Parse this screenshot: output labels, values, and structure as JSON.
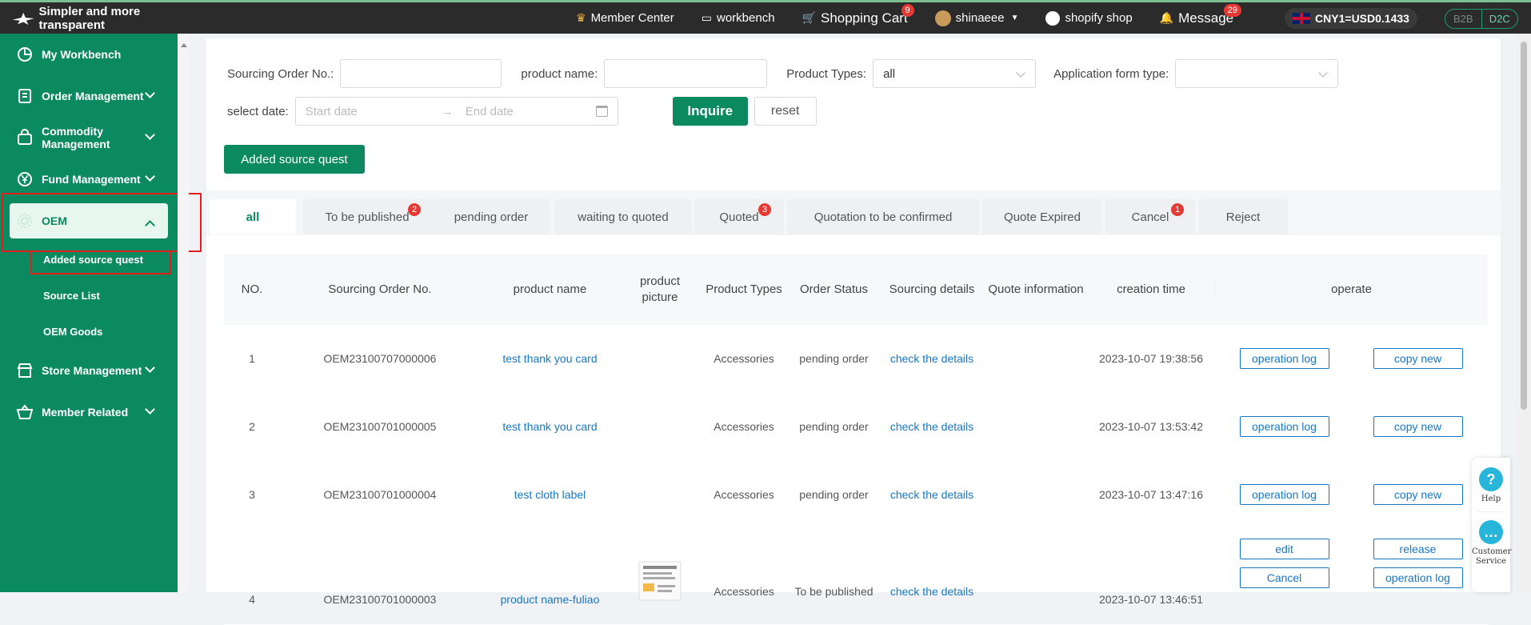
{
  "topbar": {
    "logo_text": "Simpler and more transparent",
    "member_center": "Member Center",
    "workbench": "workbench",
    "shopping_cart": "Shopping Cart",
    "cart_count": "9",
    "user": "shinaeee",
    "shopify_shop": "shopify shop",
    "message": "Message",
    "message_count": "29",
    "currency": "CNY1=USD0.1433",
    "mode_b2b": "B2B",
    "mode_d2c": "D2C"
  },
  "sidebar": {
    "items": [
      {
        "label": "My Workbench"
      },
      {
        "label": "Order Management"
      },
      {
        "label": "Commodity Management"
      },
      {
        "label": "Fund Management"
      },
      {
        "label": "OEM"
      },
      {
        "label": "Store Management"
      },
      {
        "label": "Member Related"
      }
    ],
    "oem_sub": [
      {
        "label": "Added source quest"
      },
      {
        "label": "Source List"
      },
      {
        "label": "OEM Goods"
      }
    ]
  },
  "filters": {
    "sourcing_order_label": "Sourcing Order No.:",
    "product_name_label": "product name:",
    "product_types_label": "Product Types:",
    "product_types_value": "all",
    "app_form_label": "Application form type:",
    "select_date_label": "select date:",
    "start_placeholder": "Start date",
    "end_placeholder": "End date",
    "inquire": "Inquire",
    "reset": "reset",
    "added_source_quest": "Added source quest"
  },
  "tabs": [
    {
      "label": "all",
      "badge": ""
    },
    {
      "label": "To be published",
      "badge": "2"
    },
    {
      "label": "pending order",
      "badge": ""
    },
    {
      "label": "waiting to quoted",
      "badge": ""
    },
    {
      "label": "Quoted",
      "badge": "3"
    },
    {
      "label": "Quotation to be confirmed",
      "badge": ""
    },
    {
      "label": "Quote Expired",
      "badge": ""
    },
    {
      "label": "Cancel",
      "badge": "1"
    },
    {
      "label": "Reject",
      "badge": ""
    }
  ],
  "table": {
    "headers": [
      "NO.",
      "Sourcing Order No.",
      "product name",
      "product picture",
      "Product Types",
      "Order Status",
      "Sourcing details",
      "Quote information",
      "creation time",
      "operate"
    ],
    "rows": [
      {
        "no": "1",
        "order": "OEM23100707000006",
        "name": "test thank you card",
        "type": "Accessories",
        "status": "pending order",
        "details": "check the details",
        "time": "2023-10-07 19:38:56",
        "ops": [
          "operation log",
          "copy new"
        ]
      },
      {
        "no": "2",
        "order": "OEM23100701000005",
        "name": "test thank you card",
        "type": "Accessories",
        "status": "pending order",
        "details": "check the details",
        "time": "2023-10-07 13:53:42",
        "ops": [
          "operation log",
          "copy new"
        ]
      },
      {
        "no": "3",
        "order": "OEM23100701000004",
        "name": "test cloth label",
        "type": "Accessories",
        "status": "pending order",
        "details": "check the details",
        "time": "2023-10-07 13:47:16",
        "ops": [
          "operation log",
          "copy new"
        ]
      },
      {
        "no": "4",
        "order": "OEM23100701000003",
        "name": "product name-fuliao",
        "type": "Accessories",
        "status": "To be published",
        "details": "check the details",
        "time": "2023-10-07 13:46:51",
        "ops": [
          "edit",
          "release",
          "Cancel",
          "operation log"
        ]
      }
    ]
  },
  "floating": {
    "help": "Help",
    "customer_service": "Customer Service"
  },
  "colors": {
    "brand": "#0b8a5f",
    "link": "#1677c9",
    "badge": "#e53935",
    "highlight_box": "#e02020"
  }
}
